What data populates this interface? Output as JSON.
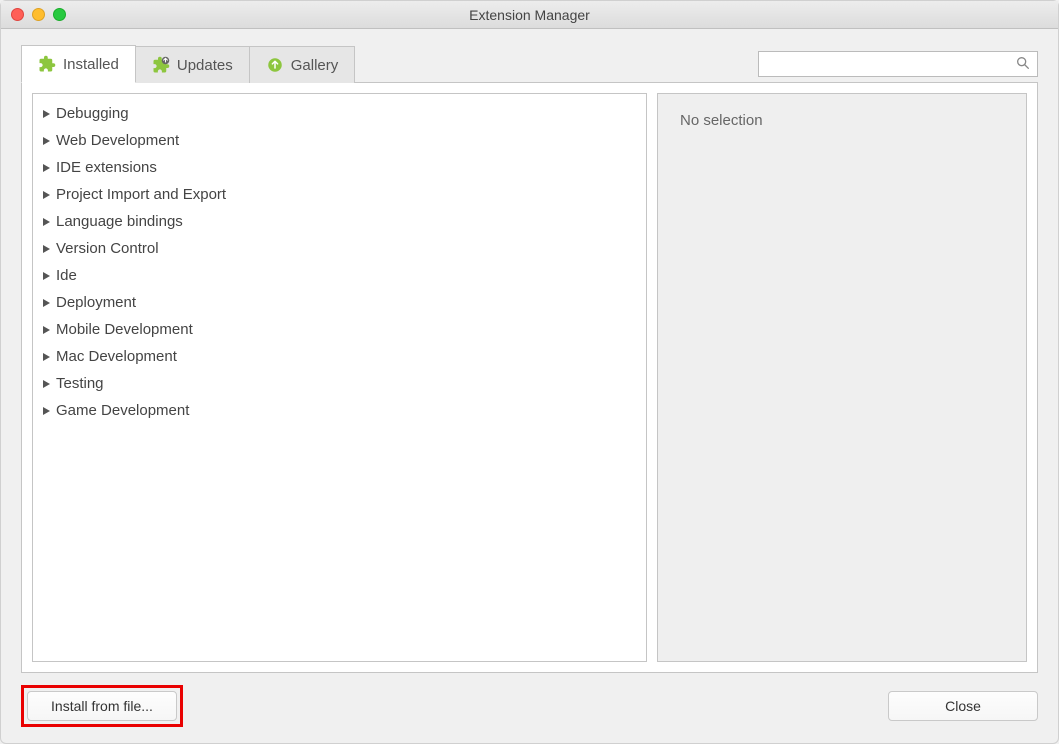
{
  "window": {
    "title": "Extension Manager"
  },
  "tabs": {
    "installed": "Installed",
    "updates": "Updates",
    "gallery": "Gallery"
  },
  "search": {
    "value": "",
    "placeholder": ""
  },
  "categories": [
    {
      "label": "Debugging"
    },
    {
      "label": "Web Development"
    },
    {
      "label": "IDE extensions"
    },
    {
      "label": "Project Import and Export"
    },
    {
      "label": "Language bindings"
    },
    {
      "label": "Version Control"
    },
    {
      "label": "Ide"
    },
    {
      "label": "Deployment"
    },
    {
      "label": "Mobile Development"
    },
    {
      "label": "Mac Development"
    },
    {
      "label": "Testing"
    },
    {
      "label": "Game Development"
    }
  ],
  "detail": {
    "empty": "No selection"
  },
  "buttons": {
    "install_from_file": "Install from file...",
    "close": "Close"
  },
  "colors": {
    "accent": "#8dc63f",
    "highlight": "#e90000"
  }
}
